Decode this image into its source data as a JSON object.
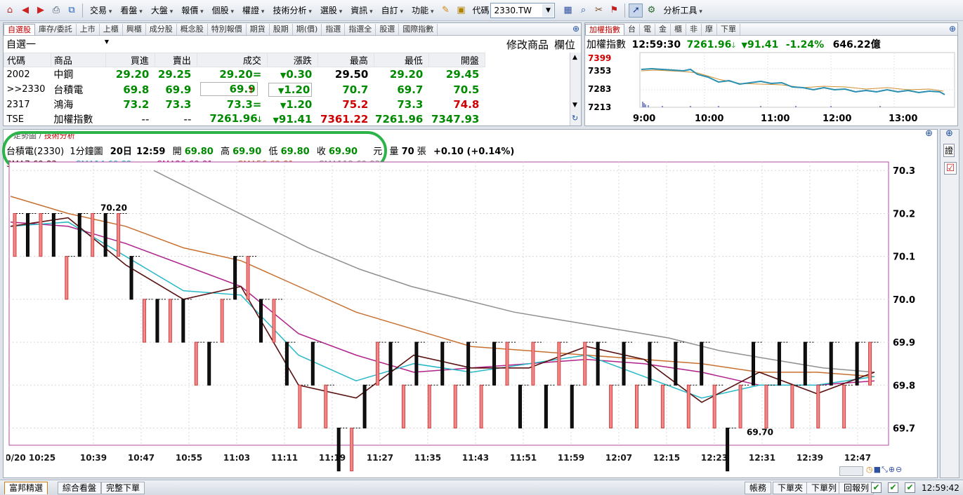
{
  "toolbar": {
    "menus": [
      "交易",
      "看盤",
      "大盤",
      "報價",
      "個股",
      "權證",
      "技術分析",
      "選股",
      "資訊",
      "自訂",
      "功能"
    ],
    "code_label": "代碼",
    "code_value": "2330.TW",
    "analysis_tools": "分析工具"
  },
  "quote_panel": {
    "tabs": [
      "自選股",
      "庫存/委託",
      "上市",
      "上櫃",
      "興櫃",
      "成分股",
      "概念股",
      "特別報價",
      "期貨",
      "股期",
      "期(價)",
      "指選",
      "指選全",
      "股選",
      "國際指數"
    ],
    "list_name": "自選一",
    "edit_label": "修改商品",
    "column_label": "欄位",
    "headers": [
      "代碼",
      "商品",
      "買進",
      "賣出",
      "成交",
      "漲跌",
      "最高",
      "最低",
      "開盤"
    ],
    "rows": [
      {
        "code": "2002",
        "name": "中鋼",
        "bid": "29.20",
        "ask": "29.25",
        "last": "29.20=",
        "change": "0.30",
        "high": "29.50",
        "low": "29.20",
        "open": "29.45"
      },
      {
        "code": ">>2330",
        "name": "台積電",
        "bid": "69.8",
        "ask": "69.9",
        "last": "69.9",
        "change": "1.20",
        "high": "70.7",
        "low": "69.7",
        "open": "70.5"
      },
      {
        "code": "2317",
        "name": "鴻海",
        "bid": "73.2",
        "ask": "73.3",
        "last": "73.3=",
        "change": "1.20",
        "high": "75.2",
        "low": "73.3",
        "open": "74.8"
      },
      {
        "code": "TSE",
        "name": "加權指數",
        "bid": "--",
        "ask": "--",
        "last": "7261.96",
        "change": "91.41",
        "high": "7361.22",
        "low": "7261.96",
        "open": "7347.93"
      }
    ]
  },
  "index_panel": {
    "tabs": [
      "加權指數",
      "台",
      "電",
      "金",
      "櫃",
      "非",
      "摩",
      "下單"
    ],
    "name": "加權指數",
    "time": "12:59:30",
    "value": "7261.96",
    "change": "91.41",
    "pct": "-1.24%",
    "volume": "646.22億",
    "y_labels": [
      "7399",
      "7353",
      "7283",
      "7213"
    ],
    "x_labels": [
      "9:00",
      "10:00",
      "11:00",
      "12:00",
      "13:00"
    ]
  },
  "chart_panel": {
    "tabs": [
      "走勢圖",
      "技術分析"
    ],
    "side_tab": "證",
    "info": {
      "symbol": "台積電(2330)",
      "period": "1分鐘圖",
      "date": "20日",
      "time": "12:59",
      "open_label": "開",
      "open": "69.80",
      "high_label": "高",
      "high": "69.90",
      "low_label": "低",
      "low": "69.80",
      "close_label": "收",
      "close": "69.90",
      "unit": "元",
      "vol_label": "量",
      "vol": "70",
      "vol_unit": "張",
      "change": "+0.10 (+0.14%)"
    },
    "sma": [
      {
        "label": "SMA7 69.83",
        "color": "#5a1010"
      },
      {
        "label": "SMA14 69.82",
        "color": "#28b8c8"
      },
      {
        "label": "SMA28 69.81",
        "color": "#b0208a"
      },
      {
        "label": "SMA56 69.81",
        "color": "#c87030"
      },
      {
        "label": "SMA112 69.83",
        "color": "#909090"
      }
    ],
    "annotations": {
      "high": "70.20",
      "low": "69.70"
    }
  },
  "chart_data": {
    "type": "candlestick",
    "y_ticks": [
      "70.3",
      "70.2",
      "70.1",
      "70.0",
      "69.9",
      "69.8",
      "69.7"
    ],
    "ylim": [
      69.66,
      70.32
    ],
    "x_labels": [
      "10/20 10:25",
      "10:39",
      "10:47",
      "10:55",
      "11:03",
      "11:11",
      "11:19",
      "11:27",
      "11:35",
      "11:43",
      "11:51",
      "11:59",
      "12:07",
      "12:15",
      "12:23",
      "12:31",
      "12:39",
      "12:47"
    ],
    "sma_series": {
      "SMA112": [
        70.3,
        70.24,
        70.18,
        70.12,
        70.07,
        70.03,
        70.0,
        69.97,
        69.95,
        69.93,
        69.91,
        69.88,
        69.86,
        69.84,
        69.83
      ],
      "SMA56": [
        70.24,
        70.2,
        70.17,
        70.12,
        70.09,
        70.03,
        69.97,
        69.93,
        69.89,
        69.88,
        69.87,
        69.86,
        69.85,
        69.83,
        69.83,
        69.82
      ],
      "SMA28": [
        70.18,
        70.17,
        70.13,
        70.08,
        70.03,
        69.92,
        69.87,
        69.83,
        69.84,
        69.85,
        69.86,
        69.85,
        69.83,
        69.8,
        69.8,
        69.81
      ],
      "SMA14": [
        70.17,
        70.18,
        70.1,
        70.02,
        70.01,
        69.87,
        69.81,
        69.85,
        69.83,
        69.85,
        69.87,
        69.82,
        69.77,
        69.8,
        69.8,
        69.82
      ],
      "SMA7": [
        70.17,
        70.19,
        70.08,
        70.0,
        70.03,
        69.8,
        69.77,
        69.87,
        69.84,
        69.84,
        69.89,
        69.86,
        69.76,
        69.83,
        69.78,
        69.83
      ]
    }
  },
  "status_bar": {
    "tabs": [
      "富邦精選",
      "綜合看盤",
      "完整下單"
    ],
    "buttons": [
      "帳務",
      "下單夾",
      "下單列",
      "回報列"
    ],
    "time": "12:59:42"
  }
}
